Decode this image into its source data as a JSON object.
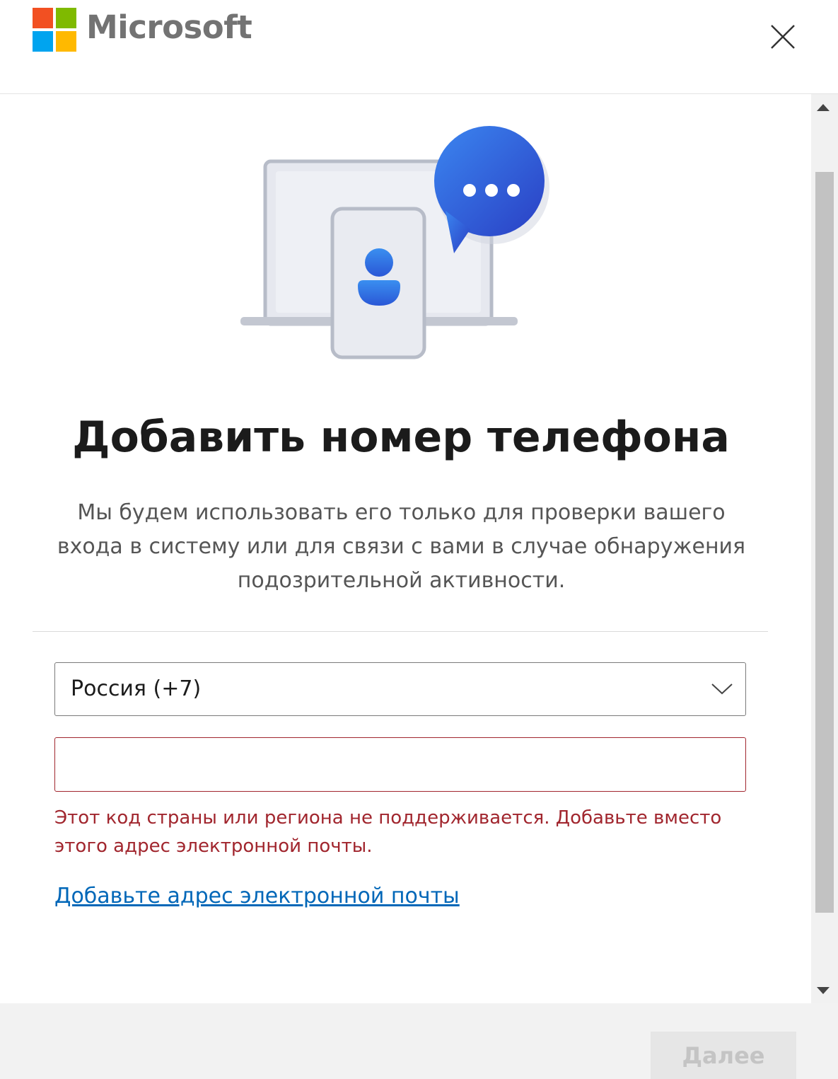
{
  "header": {
    "brand": "Microsoft",
    "logo_colors": [
      "#f25022",
      "#7fba00",
      "#00a4ef",
      "#ffb900"
    ],
    "close_icon": "close-icon"
  },
  "main": {
    "title": "Добавить номер телефона",
    "description": "Мы будем использовать его только для проверки вашего входа в систему или для связи с вами в случае обнаружения подозрительной активности.",
    "country_select": {
      "value": "Россия (+7)"
    },
    "phone_input": {
      "value": ""
    },
    "error": "Этот код страны или региона не поддерживается. Добавьте вместо этого адрес электронной почты.",
    "email_link": "Добавьте адрес электронной почты"
  },
  "footer": {
    "next_label": "Далее"
  },
  "colors": {
    "error": "#a1262e",
    "link": "#0067b8",
    "accent_blue": "#2f5bd8"
  }
}
